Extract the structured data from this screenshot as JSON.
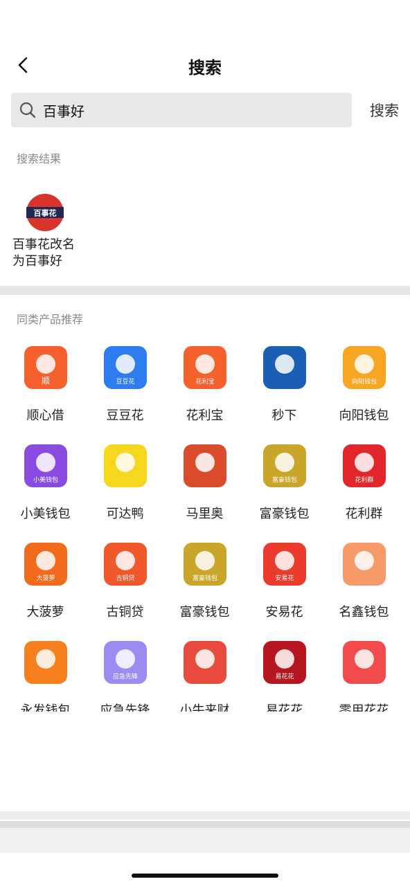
{
  "header": {
    "title": "搜索"
  },
  "search": {
    "value": "百事好",
    "submit_label": "搜索"
  },
  "results_section": {
    "label": "搜索结果"
  },
  "result": {
    "icon_text": "百事花",
    "label": "百事花改名为百事好"
  },
  "recommend_section": {
    "label": "同类产品推荐"
  },
  "apps": [
    {
      "label": "顺心借",
      "icon_text": "顺",
      "color": "#f5602d",
      "icon_name": "shunxinjie-icon"
    },
    {
      "label": "豆豆花",
      "icon_text": "豆豆花",
      "color": "#2d7cf0",
      "icon_name": "doudouhua-icon"
    },
    {
      "label": "花利宝",
      "icon_text": "花利宝",
      "color": "#f4622c",
      "icon_name": "hualibao-icon"
    },
    {
      "label": "秒下",
      "icon_text": "",
      "color": "#1a5fb4",
      "icon_name": "miaoxia-icon"
    },
    {
      "label": "向阳钱包",
      "icon_text": "向阳钱包",
      "color": "#f6a623",
      "icon_name": "xiangyang-icon"
    },
    {
      "label": "小美钱包",
      "icon_text": "小美钱包",
      "color": "#8a4be0",
      "icon_name": "xiaomei-icon"
    },
    {
      "label": "可达鸭",
      "icon_text": "",
      "color": "#f7d61e",
      "icon_name": "keda-duck-icon"
    },
    {
      "label": "马里奥",
      "icon_text": "",
      "color": "#d94b2b",
      "icon_name": "mario-icon"
    },
    {
      "label": "富豪钱包",
      "icon_text": "富豪钱包",
      "color": "#c9a62a",
      "icon_name": "fuhao-wallet-icon"
    },
    {
      "label": "花利群",
      "icon_text": "花利群",
      "color": "#e3262b",
      "icon_name": "hualiqun-icon"
    },
    {
      "label": "大菠萝",
      "icon_text": "大菠萝",
      "color": "#f26a1b",
      "icon_name": "pineapple-icon"
    },
    {
      "label": "古铜贷",
      "icon_text": "古铜贷",
      "color": "#f0572a",
      "icon_name": "gutongdai-icon"
    },
    {
      "label": "富豪钱包",
      "icon_text": "富豪钱包",
      "color": "#c9a62a",
      "icon_name": "fuhao-wallet-icon-2"
    },
    {
      "label": "安易花",
      "icon_text": "安易花",
      "color": "#ea3b2c",
      "icon_name": "anyihua-icon"
    },
    {
      "label": "名鑫钱包",
      "icon_text": "",
      "color": "#f79a6a",
      "icon_name": "mingxin-wallet-icon"
    },
    {
      "label": "永发钱包",
      "icon_text": "",
      "color": "#f6801e",
      "icon_name": "yongfa-wallet-icon"
    },
    {
      "label": "应急先锋",
      "icon_text": "应急先锋",
      "color": "#9c8bf0",
      "icon_name": "yingji-icon"
    },
    {
      "label": "小牛来财",
      "icon_text": "",
      "color": "#e84b3c",
      "icon_name": "xiaoniu-icon"
    },
    {
      "label": "易花花",
      "icon_text": "易花花",
      "color": "#b5161f",
      "icon_name": "yihuahua-icon"
    },
    {
      "label": "零用花花",
      "icon_text": "",
      "color": "#f24b4b",
      "icon_name": "lingyong-icon"
    }
  ]
}
